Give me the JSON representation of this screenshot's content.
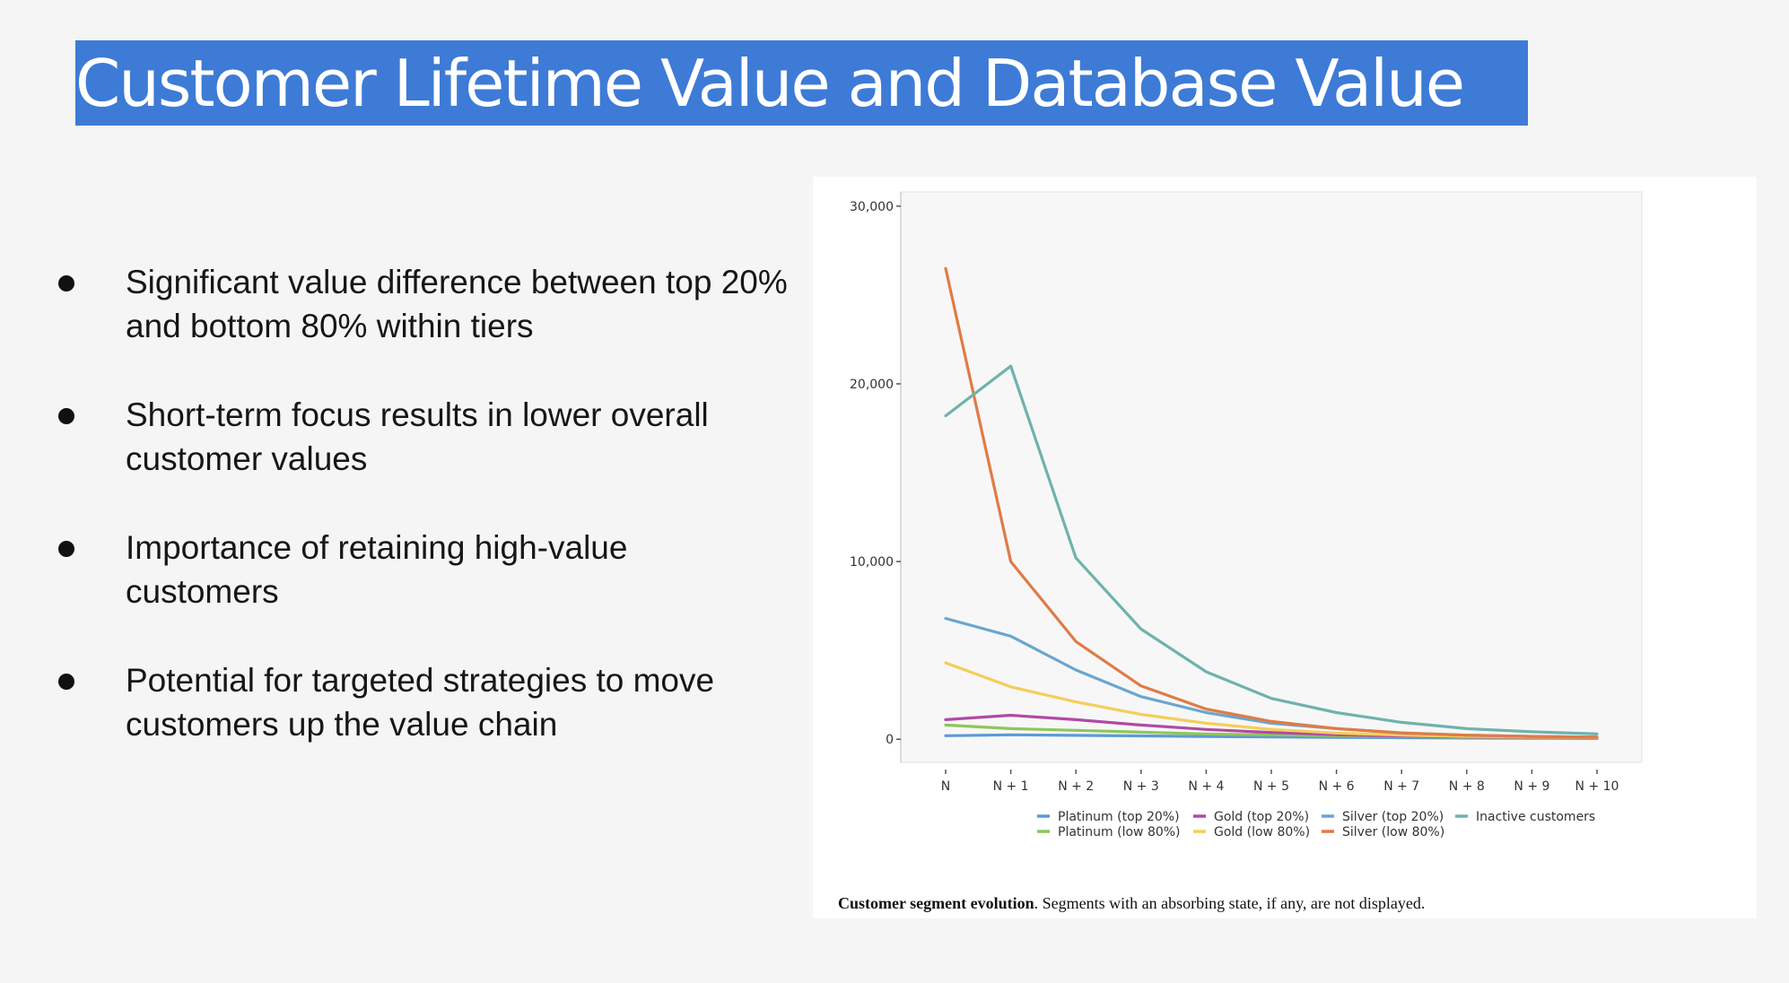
{
  "slide": {
    "title": "Customer Lifetime Value and Database Value",
    "bullets": [
      "Significant value difference between top 20% and bottom 80% within tiers",
      "Short-term focus results in lower overall customer values",
      "Importance of retaining high-value customers",
      "Potential for targeted strategies to move customers up the value chain"
    ],
    "caption_bold": "Customer segment evolution",
    "caption_rest": ". Segments with an absorbing state, if any, are not displayed."
  },
  "chart_data": {
    "type": "line",
    "title": "",
    "xlabel": "",
    "ylabel": "",
    "x": [
      "N",
      "N + 1",
      "N + 2",
      "N + 3",
      "N + 4",
      "N + 5",
      "N + 6",
      "N + 7",
      "N + 8",
      "N + 9",
      "N + 10"
    ],
    "yticks": [
      0,
      10000,
      20000,
      30000
    ],
    "ytick_labels": [
      "0",
      "10,000",
      "20,000",
      "30,000"
    ],
    "ylim": [
      -1300,
      30800
    ],
    "grid": false,
    "legend_position": "bottom",
    "series": [
      {
        "name": "Platinum (top 20%)",
        "color": "#5b9bd5",
        "values": [
          200,
          250,
          220,
          190,
          160,
          130,
          110,
          90,
          70,
          60,
          50
        ]
      },
      {
        "name": "Platinum (low 80%)",
        "color": "#8fc65a",
        "values": [
          800,
          600,
          500,
          400,
          300,
          250,
          200,
          150,
          110,
          90,
          70
        ]
      },
      {
        "name": "Gold (top 20%)",
        "color": "#b04aa5",
        "values": [
          1100,
          1350,
          1100,
          800,
          550,
          380,
          260,
          180,
          130,
          100,
          80
        ]
      },
      {
        "name": "Gold (low 80%)",
        "color": "#f5cd5b",
        "values": [
          4300,
          2950,
          2100,
          1400,
          900,
          550,
          350,
          230,
          160,
          120,
          100
        ]
      },
      {
        "name": "Silver (top 20%)",
        "color": "#6aa6cf",
        "values": [
          6800,
          5800,
          3900,
          2400,
          1500,
          900,
          600,
          350,
          230,
          160,
          120
        ]
      },
      {
        "name": "Silver (low 80%)",
        "color": "#e07b45",
        "values": [
          26500,
          10000,
          5500,
          3000,
          1700,
          1000,
          600,
          360,
          230,
          160,
          120
        ]
      },
      {
        "name": "Inactive customers",
        "color": "#6fb2ad",
        "values": [
          18200,
          21000,
          10200,
          6200,
          3800,
          2300,
          1500,
          950,
          600,
          420,
          300
        ]
      }
    ]
  }
}
